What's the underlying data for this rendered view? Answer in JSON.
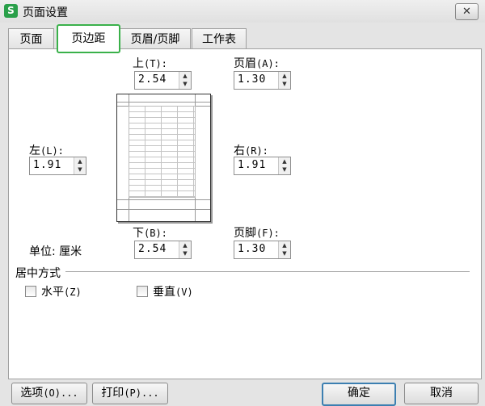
{
  "window": {
    "title": "页面设置",
    "close_glyph": "✕",
    "app_icon_letter": "S"
  },
  "tabs": [
    {
      "label": "页面"
    },
    {
      "label": "页边距"
    },
    {
      "label": "页眉/页脚"
    },
    {
      "label": "工作表"
    }
  ],
  "margins": {
    "top": {
      "label": "上",
      "accel": "(T):",
      "value": "2.54"
    },
    "bottom": {
      "label": "下",
      "accel": "(B):",
      "value": "2.54"
    },
    "left": {
      "label": "左",
      "accel": "(L):",
      "value": "1.91"
    },
    "right": {
      "label": "右",
      "accel": "(R):",
      "value": "1.91"
    },
    "header": {
      "label": "页眉",
      "accel": "(A):",
      "value": "1.30"
    },
    "footer": {
      "label": "页脚",
      "accel": "(F):",
      "value": "1.30"
    }
  },
  "unit": {
    "text": "单位: 厘米"
  },
  "centering": {
    "title": "居中方式",
    "horizontal": {
      "label": "水平",
      "accel": "(Z)",
      "checked": false
    },
    "vertical": {
      "label": "垂直",
      "accel": "(V)",
      "checked": false
    }
  },
  "buttons": {
    "options": {
      "label": "选项",
      "accel": "(O)..."
    },
    "print": {
      "label": "打印",
      "accel": "(P)..."
    },
    "ok": {
      "label": "确定"
    },
    "cancel": {
      "label": "取消"
    }
  },
  "icons": {
    "spin_up": "up-arrow-icon",
    "spin_down": "down-arrow-icon",
    "close": "close-icon",
    "app": "wps-spreadsheet-icon"
  },
  "colors": {
    "active_tab_border": "#3ab14a",
    "default_button_border": "#3c7fb1",
    "app_icon": "#2aa04a"
  }
}
